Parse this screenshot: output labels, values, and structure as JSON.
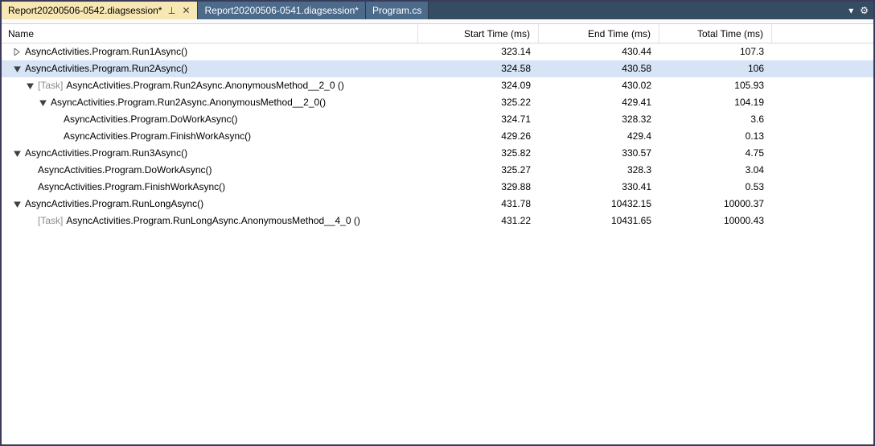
{
  "tabs": [
    {
      "label": "Report20200506-0542.diagsession*",
      "active": true,
      "pinned": true,
      "closeable": true
    },
    {
      "label": "Report20200506-0541.diagsession*",
      "active": false,
      "pinned": false,
      "closeable": false
    },
    {
      "label": "Program.cs",
      "active": false,
      "pinned": false,
      "closeable": false
    }
  ],
  "columns": {
    "name": "Name",
    "start": "Start Time (ms)",
    "end": "End Time (ms)",
    "total": "Total Time (ms)"
  },
  "rows": [
    {
      "indent": 0,
      "expander": "closed",
      "task": false,
      "name": "AsyncActivities.Program.Run1Async()",
      "start": "323.14",
      "end": "430.44",
      "total": "107.3",
      "selected": false
    },
    {
      "indent": 0,
      "expander": "open",
      "task": false,
      "name": "AsyncActivities.Program.Run2Async()",
      "start": "324.58",
      "end": "430.58",
      "total": "106",
      "selected": true
    },
    {
      "indent": 1,
      "expander": "open",
      "task": true,
      "name": "AsyncActivities.Program.Run2Async.AnonymousMethod__2_0 ()",
      "start": "324.09",
      "end": "430.02",
      "total": "105.93",
      "selected": false
    },
    {
      "indent": 2,
      "expander": "open",
      "task": false,
      "name": "AsyncActivities.Program.Run2Async.AnonymousMethod__2_0()",
      "start": "325.22",
      "end": "429.41",
      "total": "104.19",
      "selected": false
    },
    {
      "indent": 3,
      "expander": "none",
      "task": false,
      "name": "AsyncActivities.Program.DoWorkAsync()",
      "start": "324.71",
      "end": "328.32",
      "total": "3.6",
      "selected": false
    },
    {
      "indent": 3,
      "expander": "none",
      "task": false,
      "name": "AsyncActivities.Program.FinishWorkAsync()",
      "start": "429.26",
      "end": "429.4",
      "total": "0.13",
      "selected": false
    },
    {
      "indent": 0,
      "expander": "open",
      "task": false,
      "name": "AsyncActivities.Program.Run3Async()",
      "start": "325.82",
      "end": "330.57",
      "total": "4.75",
      "selected": false
    },
    {
      "indent": 1,
      "expander": "none",
      "task": false,
      "name": "AsyncActivities.Program.DoWorkAsync()",
      "start": "325.27",
      "end": "328.3",
      "total": "3.04",
      "selected": false
    },
    {
      "indent": 1,
      "expander": "none",
      "task": false,
      "name": "AsyncActivities.Program.FinishWorkAsync()",
      "start": "329.88",
      "end": "330.41",
      "total": "0.53",
      "selected": false
    },
    {
      "indent": 0,
      "expander": "open",
      "task": false,
      "name": "AsyncActivities.Program.RunLongAsync()",
      "start": "431.78",
      "end": "10432.15",
      "total": "10000.37",
      "selected": false
    },
    {
      "indent": 1,
      "expander": "none",
      "task": true,
      "name": "AsyncActivities.Program.RunLongAsync.AnonymousMethod__4_0 ()",
      "start": "431.22",
      "end": "10431.65",
      "total": "10000.43",
      "selected": false
    }
  ],
  "taskPrefix": "[Task]"
}
